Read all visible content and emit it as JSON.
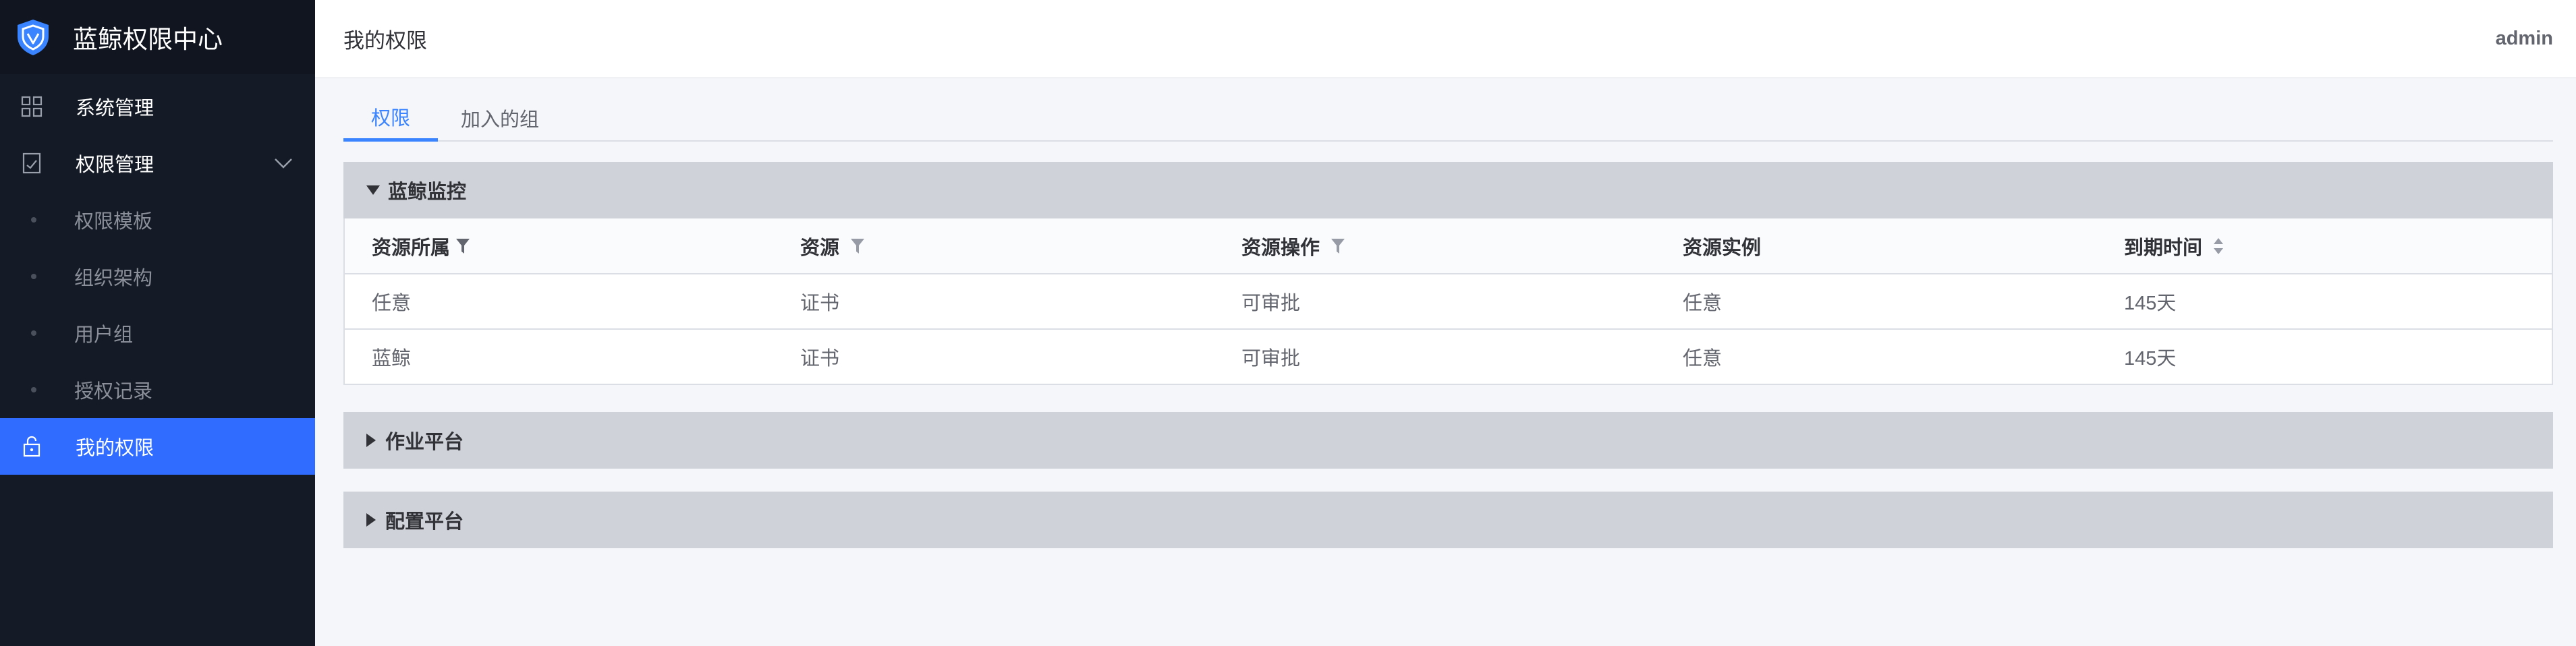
{
  "sidebar": {
    "brand": "蓝鲸权限中心",
    "menu": [
      {
        "label": "系统管理",
        "icon": "grid-icon"
      },
      {
        "label": "权限管理",
        "icon": "clipboard-icon"
      }
    ],
    "sub_items": [
      "权限模板",
      "组织架构",
      "用户组",
      "授权记录"
    ],
    "active_item": {
      "label": "我的权限",
      "icon": "lock-icon"
    }
  },
  "header": {
    "title": "我的权限",
    "user": "admin"
  },
  "tabs": [
    "权限",
    "加入的组"
  ],
  "panels": [
    {
      "title": "蓝鲸监控",
      "expanded": true,
      "columns": [
        "资源所属",
        "资源",
        "资源操作",
        "资源实例",
        "到期时间"
      ],
      "rows": [
        [
          "任意",
          "证书",
          "可审批",
          "任意",
          "145天"
        ],
        [
          "蓝鲸",
          "证书",
          "可审批",
          "任意",
          "145天"
        ]
      ]
    },
    {
      "title": "作业平台",
      "expanded": false
    },
    {
      "title": "配置平台",
      "expanded": false
    }
  ],
  "colors": {
    "sidebar_bg": "#151b26",
    "active_bg": "#2f6cff",
    "accent": "#3a84ff",
    "panel_head_bg": "#d0d2d9"
  }
}
